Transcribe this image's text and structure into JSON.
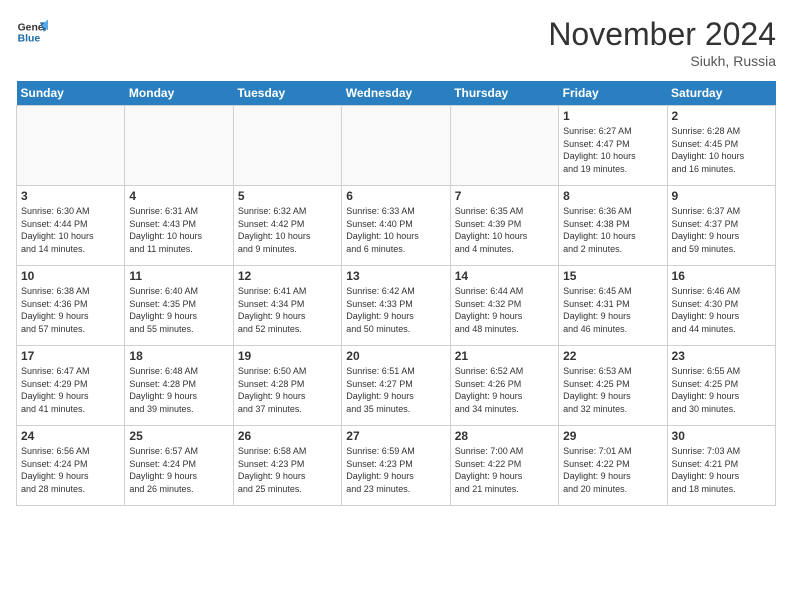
{
  "logo": {
    "line1": "General",
    "line2": "Blue"
  },
  "title": "November 2024",
  "location": "Siukh, Russia",
  "days_of_week": [
    "Sunday",
    "Monday",
    "Tuesday",
    "Wednesday",
    "Thursday",
    "Friday",
    "Saturday"
  ],
  "weeks": [
    [
      {
        "day": "",
        "info": ""
      },
      {
        "day": "",
        "info": ""
      },
      {
        "day": "",
        "info": ""
      },
      {
        "day": "",
        "info": ""
      },
      {
        "day": "",
        "info": ""
      },
      {
        "day": "1",
        "info": "Sunrise: 6:27 AM\nSunset: 4:47 PM\nDaylight: 10 hours\nand 19 minutes."
      },
      {
        "day": "2",
        "info": "Sunrise: 6:28 AM\nSunset: 4:45 PM\nDaylight: 10 hours\nand 16 minutes."
      }
    ],
    [
      {
        "day": "3",
        "info": "Sunrise: 6:30 AM\nSunset: 4:44 PM\nDaylight: 10 hours\nand 14 minutes."
      },
      {
        "day": "4",
        "info": "Sunrise: 6:31 AM\nSunset: 4:43 PM\nDaylight: 10 hours\nand 11 minutes."
      },
      {
        "day": "5",
        "info": "Sunrise: 6:32 AM\nSunset: 4:42 PM\nDaylight: 10 hours\nand 9 minutes."
      },
      {
        "day": "6",
        "info": "Sunrise: 6:33 AM\nSunset: 4:40 PM\nDaylight: 10 hours\nand 6 minutes."
      },
      {
        "day": "7",
        "info": "Sunrise: 6:35 AM\nSunset: 4:39 PM\nDaylight: 10 hours\nand 4 minutes."
      },
      {
        "day": "8",
        "info": "Sunrise: 6:36 AM\nSunset: 4:38 PM\nDaylight: 10 hours\nand 2 minutes."
      },
      {
        "day": "9",
        "info": "Sunrise: 6:37 AM\nSunset: 4:37 PM\nDaylight: 9 hours\nand 59 minutes."
      }
    ],
    [
      {
        "day": "10",
        "info": "Sunrise: 6:38 AM\nSunset: 4:36 PM\nDaylight: 9 hours\nand 57 minutes."
      },
      {
        "day": "11",
        "info": "Sunrise: 6:40 AM\nSunset: 4:35 PM\nDaylight: 9 hours\nand 55 minutes."
      },
      {
        "day": "12",
        "info": "Sunrise: 6:41 AM\nSunset: 4:34 PM\nDaylight: 9 hours\nand 52 minutes."
      },
      {
        "day": "13",
        "info": "Sunrise: 6:42 AM\nSunset: 4:33 PM\nDaylight: 9 hours\nand 50 minutes."
      },
      {
        "day": "14",
        "info": "Sunrise: 6:44 AM\nSunset: 4:32 PM\nDaylight: 9 hours\nand 48 minutes."
      },
      {
        "day": "15",
        "info": "Sunrise: 6:45 AM\nSunset: 4:31 PM\nDaylight: 9 hours\nand 46 minutes."
      },
      {
        "day": "16",
        "info": "Sunrise: 6:46 AM\nSunset: 4:30 PM\nDaylight: 9 hours\nand 44 minutes."
      }
    ],
    [
      {
        "day": "17",
        "info": "Sunrise: 6:47 AM\nSunset: 4:29 PM\nDaylight: 9 hours\nand 41 minutes."
      },
      {
        "day": "18",
        "info": "Sunrise: 6:48 AM\nSunset: 4:28 PM\nDaylight: 9 hours\nand 39 minutes."
      },
      {
        "day": "19",
        "info": "Sunrise: 6:50 AM\nSunset: 4:28 PM\nDaylight: 9 hours\nand 37 minutes."
      },
      {
        "day": "20",
        "info": "Sunrise: 6:51 AM\nSunset: 4:27 PM\nDaylight: 9 hours\nand 35 minutes."
      },
      {
        "day": "21",
        "info": "Sunrise: 6:52 AM\nSunset: 4:26 PM\nDaylight: 9 hours\nand 34 minutes."
      },
      {
        "day": "22",
        "info": "Sunrise: 6:53 AM\nSunset: 4:25 PM\nDaylight: 9 hours\nand 32 minutes."
      },
      {
        "day": "23",
        "info": "Sunrise: 6:55 AM\nSunset: 4:25 PM\nDaylight: 9 hours\nand 30 minutes."
      }
    ],
    [
      {
        "day": "24",
        "info": "Sunrise: 6:56 AM\nSunset: 4:24 PM\nDaylight: 9 hours\nand 28 minutes."
      },
      {
        "day": "25",
        "info": "Sunrise: 6:57 AM\nSunset: 4:24 PM\nDaylight: 9 hours\nand 26 minutes."
      },
      {
        "day": "26",
        "info": "Sunrise: 6:58 AM\nSunset: 4:23 PM\nDaylight: 9 hours\nand 25 minutes."
      },
      {
        "day": "27",
        "info": "Sunrise: 6:59 AM\nSunset: 4:23 PM\nDaylight: 9 hours\nand 23 minutes."
      },
      {
        "day": "28",
        "info": "Sunrise: 7:00 AM\nSunset: 4:22 PM\nDaylight: 9 hours\nand 21 minutes."
      },
      {
        "day": "29",
        "info": "Sunrise: 7:01 AM\nSunset: 4:22 PM\nDaylight: 9 hours\nand 20 minutes."
      },
      {
        "day": "30",
        "info": "Sunrise: 7:03 AM\nSunset: 4:21 PM\nDaylight: 9 hours\nand 18 minutes."
      }
    ]
  ]
}
